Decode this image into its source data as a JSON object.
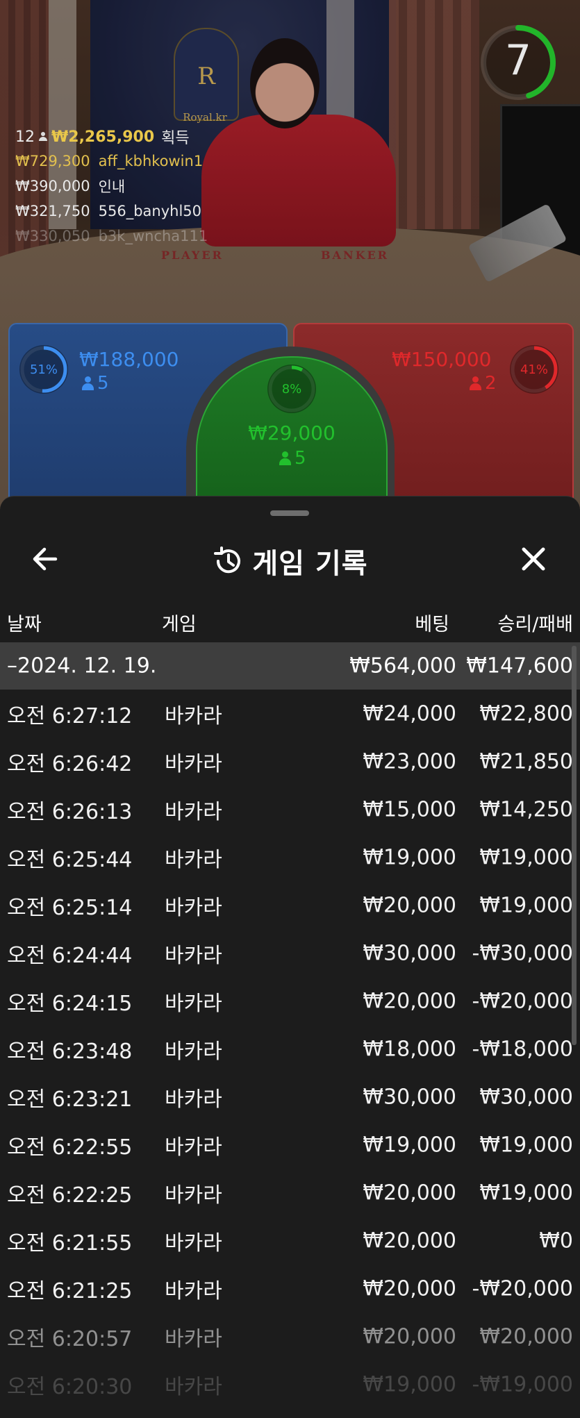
{
  "video": {
    "crest_letter": "R",
    "crest_text": "Royal.kr",
    "table_player": "PLAYER",
    "table_banker": "BANKER",
    "timer": "7",
    "timer_fraction": 0.45,
    "timer_color": "#22b52a"
  },
  "winners": {
    "count": "12",
    "total": "₩2,265,900",
    "total_suffix": "획득",
    "rows": [
      {
        "amount": "₩729,300",
        "name": "aff_kbhkowin1"
      },
      {
        "amount": "₩390,000",
        "name": "인내"
      },
      {
        "amount": "₩321,750",
        "name": "556_banyhl50"
      },
      {
        "amount": "₩330,050",
        "name": "b3k_wncha111"
      }
    ]
  },
  "bets": {
    "player": {
      "percent": "51%",
      "percent_value": 51,
      "amount": "₩188,000",
      "players": "5",
      "color": "#3d8ef0"
    },
    "tie": {
      "percent": "8%",
      "percent_value": 8,
      "amount": "₩29,000",
      "players": "5",
      "color": "#22c02d"
    },
    "banker": {
      "percent": "41%",
      "percent_value": 41,
      "amount": "₩150,000",
      "players": "2",
      "color": "#e0282b"
    }
  },
  "sheet": {
    "title": "게임 기록",
    "icons": {
      "back": "arrow-left-icon",
      "history": "history-icon",
      "close": "close-icon"
    },
    "columns": {
      "date": "날짜",
      "game": "게임",
      "bet": "베팅",
      "result": "승리/패배"
    },
    "date_group": {
      "label": "–2024. 12. 19.",
      "bet_total": "₩564,000",
      "result_total": "₩147,600"
    },
    "rows": [
      {
        "time": "오전 6:27:12",
        "game": "바카라",
        "bet": "₩24,000",
        "result": "₩22,800"
      },
      {
        "time": "오전 6:26:42",
        "game": "바카라",
        "bet": "₩23,000",
        "result": "₩21,850"
      },
      {
        "time": "오전 6:26:13",
        "game": "바카라",
        "bet": "₩15,000",
        "result": "₩14,250"
      },
      {
        "time": "오전 6:25:44",
        "game": "바카라",
        "bet": "₩19,000",
        "result": "₩19,000"
      },
      {
        "time": "오전 6:25:14",
        "game": "바카라",
        "bet": "₩20,000",
        "result": "₩19,000"
      },
      {
        "time": "오전 6:24:44",
        "game": "바카라",
        "bet": "₩30,000",
        "result": "-₩30,000"
      },
      {
        "time": "오전 6:24:15",
        "game": "바카라",
        "bet": "₩20,000",
        "result": "-₩20,000"
      },
      {
        "time": "오전 6:23:48",
        "game": "바카라",
        "bet": "₩18,000",
        "result": "-₩18,000"
      },
      {
        "time": "오전 6:23:21",
        "game": "바카라",
        "bet": "₩30,000",
        "result": "₩30,000"
      },
      {
        "time": "오전 6:22:55",
        "game": "바카라",
        "bet": "₩19,000",
        "result": "₩19,000"
      },
      {
        "time": "오전 6:22:25",
        "game": "바카라",
        "bet": "₩20,000",
        "result": "₩19,000"
      },
      {
        "time": "오전 6:21:55",
        "game": "바카라",
        "bet": "₩20,000",
        "result": "₩0"
      },
      {
        "time": "오전 6:21:25",
        "game": "바카라",
        "bet": "₩20,000",
        "result": "-₩20,000"
      },
      {
        "time": "오전 6:20:57",
        "game": "바카라",
        "bet": "₩20,000",
        "result": "₩20,000"
      },
      {
        "time": "오전 6:20:30",
        "game": "바카라",
        "bet": "₩19,000",
        "result": "-₩19,000"
      }
    ]
  }
}
